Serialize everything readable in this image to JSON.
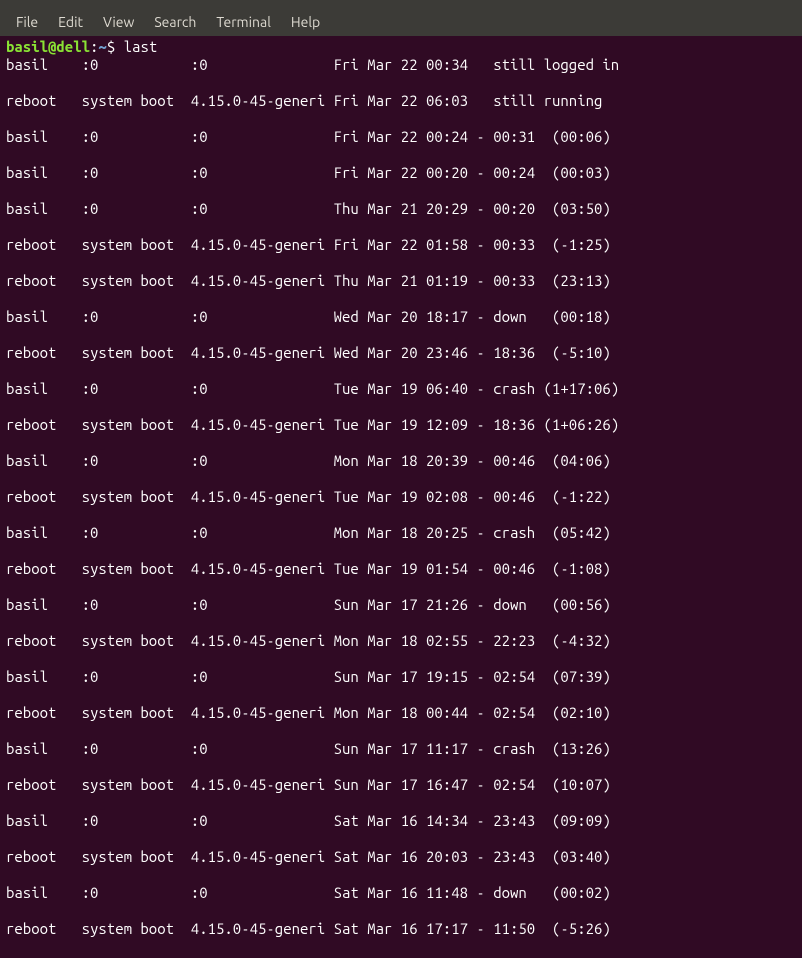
{
  "menubar": {
    "items": [
      "File",
      "Edit",
      "View",
      "Search",
      "Terminal",
      "Help"
    ]
  },
  "prompt": {
    "user_host": "basil@dell",
    "colon": ":",
    "path": "~",
    "dollar": "$ "
  },
  "command": "last",
  "output_lines": [
    "basil    :0           :0               Fri Mar 22 00:34   still logged in",
    "reboot   system boot  4.15.0-45-generi Fri Mar 22 06:03   still running",
    "basil    :0           :0               Fri Mar 22 00:24 - 00:31  (00:06)",
    "basil    :0           :0               Fri Mar 22 00:20 - 00:24  (00:03)",
    "basil    :0           :0               Thu Mar 21 20:29 - 00:20  (03:50)",
    "reboot   system boot  4.15.0-45-generi Fri Mar 22 01:58 - 00:33  (-1:25)",
    "reboot   system boot  4.15.0-45-generi Thu Mar 21 01:19 - 00:33  (23:13)",
    "basil    :0           :0               Wed Mar 20 18:17 - down   (00:18)",
    "reboot   system boot  4.15.0-45-generi Wed Mar 20 23:46 - 18:36  (-5:10)",
    "basil    :0           :0               Tue Mar 19 06:40 - crash (1+17:06)",
    "reboot   system boot  4.15.0-45-generi Tue Mar 19 12:09 - 18:36 (1+06:26)",
    "basil    :0           :0               Mon Mar 18 20:39 - 00:46  (04:06)",
    "reboot   system boot  4.15.0-45-generi Tue Mar 19 02:08 - 00:46  (-1:22)",
    "basil    :0           :0               Mon Mar 18 20:25 - crash  (05:42)",
    "reboot   system boot  4.15.0-45-generi Tue Mar 19 01:54 - 00:46  (-1:08)",
    "basil    :0           :0               Sun Mar 17 21:26 - down   (00:56)",
    "reboot   system boot  4.15.0-45-generi Mon Mar 18 02:55 - 22:23  (-4:32)",
    "basil    :0           :0               Sun Mar 17 19:15 - 02:54  (07:39)",
    "reboot   system boot  4.15.0-45-generi Mon Mar 18 00:44 - 02:54  (02:10)",
    "basil    :0           :0               Sun Mar 17 11:17 - crash  (13:26)",
    "reboot   system boot  4.15.0-45-generi Sun Mar 17 16:47 - 02:54  (10:07)",
    "basil    :0           :0               Sat Mar 16 14:34 - 23:43  (09:09)",
    "reboot   system boot  4.15.0-45-generi Sat Mar 16 20:03 - 23:43  (03:40)",
    "basil    :0           :0               Sat Mar 16 11:48 - down   (00:02)",
    "reboot   system boot  4.15.0-45-generi Sat Mar 16 17:17 - 11:50  (-5:26)"
  ]
}
